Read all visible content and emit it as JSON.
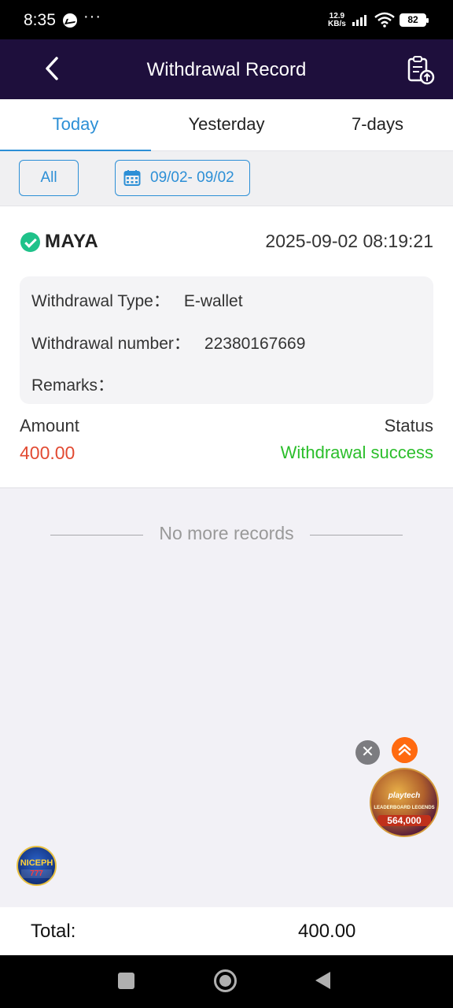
{
  "status_bar": {
    "time": "8:35",
    "more": "···",
    "net_speed_value": "12.9",
    "net_speed_unit": "KB/s",
    "battery": "82",
    "icons": [
      "messenger-icon",
      "signal-icon",
      "wifi-icon",
      "battery-icon"
    ]
  },
  "header": {
    "title": "Withdrawal Record",
    "back_icon": "chevron-left-icon",
    "right_icon": "clipboard-upload-icon",
    "background": "#1e0f3c"
  },
  "tabs": [
    {
      "label": "Today",
      "active": true
    },
    {
      "label": "Yesterday",
      "active": false
    },
    {
      "label": "7-days",
      "active": false
    }
  ],
  "filters": {
    "all_label": "All",
    "date_range": "09/02- 09/02",
    "calendar_icon": "calendar-icon"
  },
  "record": {
    "provider": "MAYA",
    "datetime": "2025-09-02 08:19:21",
    "type_label": "Withdrawal Type：",
    "type_value": "E-wallet",
    "number_label": "Withdrawal number：",
    "number_value": "22380167669",
    "remarks_label": "Remarks：",
    "remarks_value": "",
    "amount_label": "Amount",
    "amount_value": "400.00",
    "status_label": "Status",
    "status_value": "Withdrawal success",
    "amount_color": "#e24a32",
    "status_color": "#2bbe2b"
  },
  "list_end": "No more records",
  "floating": {
    "close_symbol": "✕",
    "promo_brand": "playtech",
    "promo_subtitle": "LEADERBOARD LEGENDS",
    "promo_amount": "564,000",
    "site_badge": "NICEPH",
    "site_badge_sub": "777"
  },
  "total": {
    "label": "Total:",
    "value": "400.00"
  },
  "accent_color": "#2c8fd6"
}
